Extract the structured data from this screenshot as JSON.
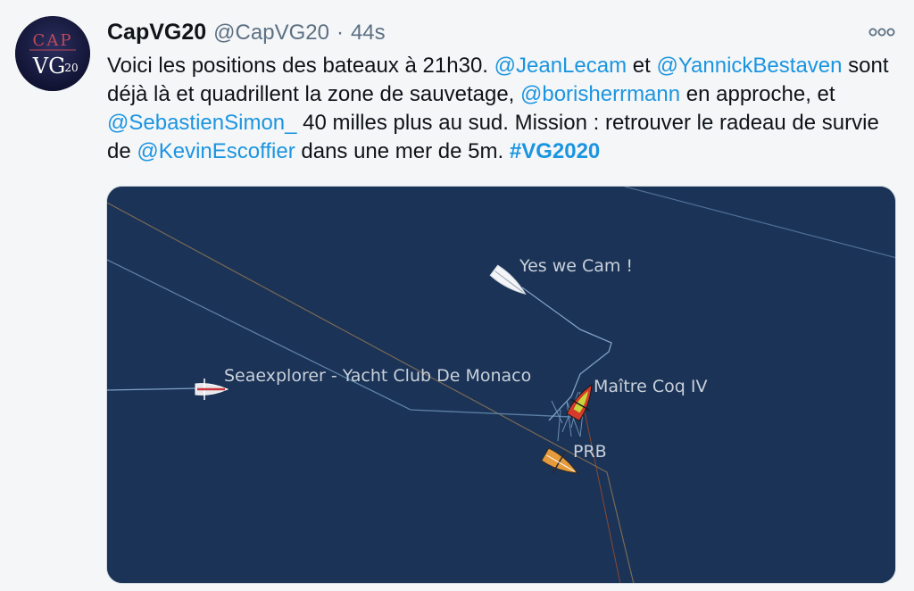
{
  "tweet": {
    "avatar": {
      "text_top": "CAP",
      "text_bottom": "VG",
      "text_num": "20"
    },
    "display_name": "CapVG20",
    "handle": "@CapVG20",
    "separator": "·",
    "timestamp": "44s",
    "body": {
      "t1": "Voici les positions des bateaux à 21h30. ",
      "m1": "@JeanLecam",
      "t2": " et ",
      "m2": "@YannickBestaven",
      "t3": " sont déjà là et quadrillent la zone de sauvetage, ",
      "m3": "@borisherrmann",
      "t4": " en approche, et ",
      "m4": "@SebastienSimon_",
      "t5": " 40 milles plus au sud. Mission : retrouver le radeau de survie de ",
      "m5": "@KevinEscoffier",
      "t6": " dans une mer de 5m. ",
      "hashtag": "#VG2020"
    },
    "colors": {
      "link": "#1b95e0",
      "map_sea": "#1b3356"
    }
  },
  "map": {
    "labels": {
      "yes_we_cam": "Yes we Cam !",
      "seaexplorer": "Seaexplorer - Yacht Club De Monaco",
      "maitre_coq": "Maître Coq IV",
      "prb": "PRB"
    }
  }
}
